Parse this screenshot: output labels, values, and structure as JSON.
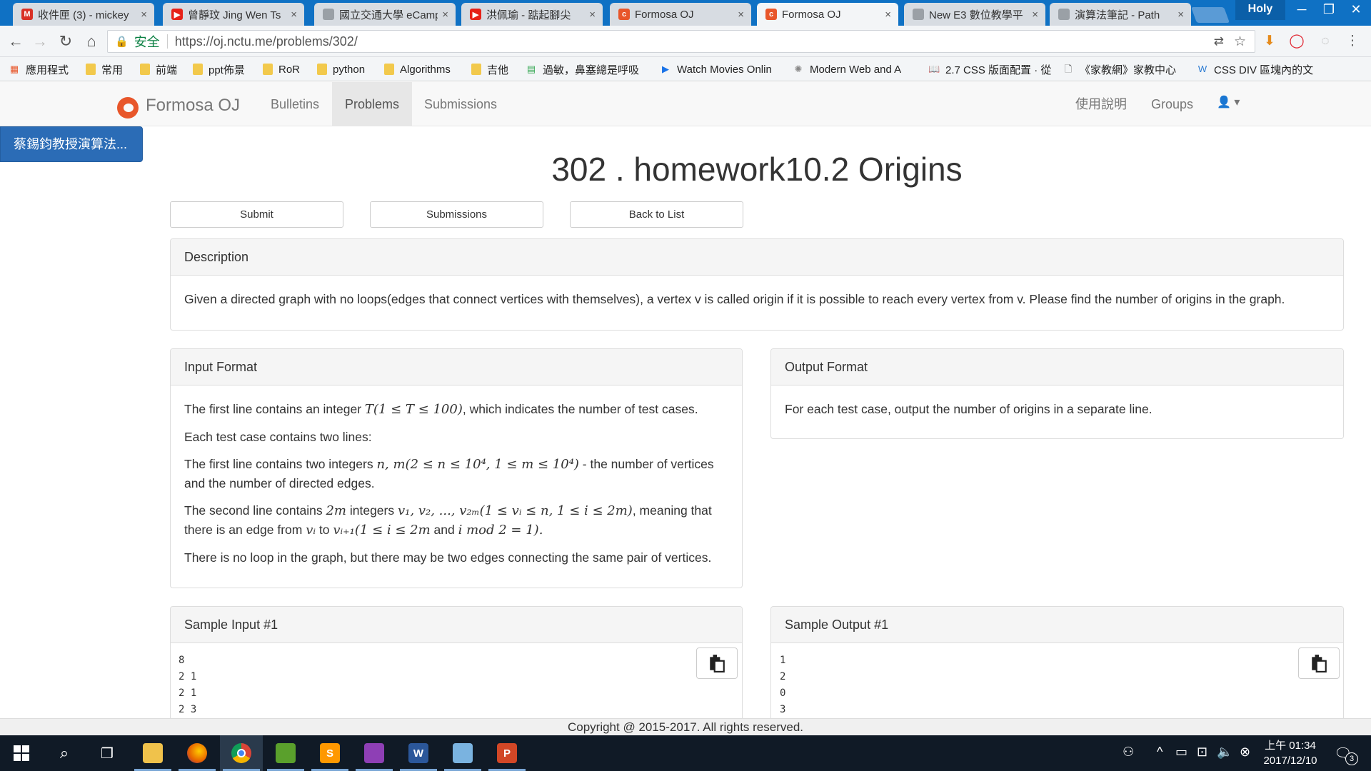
{
  "browser": {
    "tabs": [
      {
        "title": "收件匣 (3) - mickey",
        "icon": "gmail-icon",
        "color": "#d93025",
        "glyph": "M"
      },
      {
        "title": "曾靜玟 Jing Wen Ts",
        "icon": "youtube-icon",
        "color": "#e62117",
        "glyph": "▶"
      },
      {
        "title": "國立交通大學 eCamp",
        "icon": "document-icon",
        "color": "#9aa0a6",
        "glyph": ""
      },
      {
        "title": "洪佩瑜 - 踮起腳尖",
        "icon": "youtube-icon",
        "color": "#e62117",
        "glyph": "▶"
      },
      {
        "title": "Formosa OJ",
        "icon": "formosa-oj-icon",
        "color": "#e8562a",
        "glyph": "c"
      },
      {
        "title": "Formosa OJ",
        "icon": "formosa-oj-icon",
        "color": "#e8562a",
        "glyph": "c"
      },
      {
        "title": "New E3 數位教學平",
        "icon": "document-icon",
        "color": "#9aa0a6",
        "glyph": ""
      },
      {
        "title": "演算法筆記 - Path",
        "icon": "document-icon",
        "color": "#9aa0a6",
        "glyph": ""
      }
    ],
    "profile_name": "Holy",
    "secure_label": "安全",
    "url": "https://oj.nctu.me/problems/302/",
    "bookmarks": [
      {
        "label": "應用程式",
        "icon": "apps-grid-icon",
        "kind": "icon",
        "glyph": "▦",
        "color": "#e8562a"
      },
      {
        "label": "常用",
        "kind": "folder"
      },
      {
        "label": "前端",
        "kind": "folder"
      },
      {
        "label": "ppt佈景",
        "kind": "folder"
      },
      {
        "label": "RoR",
        "kind": "folder"
      },
      {
        "label": "python",
        "kind": "folder"
      },
      {
        "label": "Algorithms",
        "kind": "folder"
      },
      {
        "label": "吉他",
        "kind": "folder"
      },
      {
        "label": "過敏，鼻塞總是呼吸",
        "icon": "sheet-icon",
        "kind": "icon",
        "glyph": "▤",
        "color": "#34a853"
      },
      {
        "label": "Watch Movies Onlin",
        "icon": "play-circle-icon",
        "kind": "icon",
        "glyph": "▶",
        "color": "#1a73e8"
      },
      {
        "label": "Modern Web and A",
        "icon": "globe-icon",
        "kind": "icon",
        "glyph": "✺",
        "color": "#888"
      },
      {
        "label": "2.7 CSS 版面配置 · 從",
        "icon": "book-icon",
        "kind": "icon",
        "glyph": "📖",
        "color": "#333"
      },
      {
        "label": "《家教網》家教中心",
        "icon": "document-icon",
        "kind": "icon",
        "glyph": "🗋",
        "color": "#555"
      },
      {
        "label": "CSS DIV 區塊內的文",
        "icon": "w-icon",
        "kind": "icon",
        "glyph": "W",
        "color": "#2b7bd3"
      }
    ]
  },
  "site": {
    "brand": "Formosa OJ",
    "nav": {
      "bulletins": "Bulletins",
      "problems": "Problems",
      "submissions": "Submissions",
      "help": "使用說明",
      "groups": "Groups"
    },
    "course_chip": "蔡錫鈞教授演算法..."
  },
  "problem": {
    "title": "302 . homework10.2 Origins",
    "buttons": {
      "submit": "Submit",
      "submissions": "Submissions",
      "back": "Back to List"
    },
    "description": {
      "heading": "Description",
      "text": "Given a directed graph with no loops(edges that connect vertices with themselves), a vertex v is called origin if it is possible to reach every vertex from v. Please find the number of origins in the graph."
    },
    "input_format": {
      "heading": "Input Format",
      "p1_pre": "The first line contains an integer ",
      "p1_math": "T(1 ≤ T ≤ 100)",
      "p1_post": ", which indicates the number of test cases.",
      "p2": "Each test case contains two lines:",
      "p3_pre": "The first line contains two integers ",
      "p3_math": "n, m(2 ≤ n ≤ 10⁴, 1 ≤ m ≤ 10⁴)",
      "p3_post": " - the number of vertices and the number of directed edges.",
      "p4_a": "The second line contains ",
      "p4_m1": "2m",
      "p4_b": " integers ",
      "p4_m2": "v₁, v₂, ..., v₂ₘ(1 ≤ vᵢ ≤ n, 1 ≤ i ≤ 2m)",
      "p4_c": ", meaning that there is an edge from ",
      "p4_m3": "vᵢ",
      "p4_d": " to ",
      "p4_m4": "vᵢ₊₁(1 ≤ i ≤ 2m",
      "p4_e": " and ",
      "p4_m5": "i  mod 2 = 1).",
      "p5": "There is no loop in the graph, but there may be two edges connecting the same pair of vertices."
    },
    "output_format": {
      "heading": "Output Format",
      "text": "For each test case, output the number of origins in a separate line."
    },
    "sample_input": {
      "heading": "Sample Input #1",
      "lines": "8\n2 1\n2 1\n2 3"
    },
    "sample_output": {
      "heading": "Sample Output #1",
      "lines": "1\n2\n0\n3"
    }
  },
  "footer": {
    "copyright": "Copyright @ 2015-2017. All rights reserved."
  },
  "taskbar": {
    "apps": [
      {
        "name": "file-explorer-icon",
        "glyph": "",
        "color": "#f0c24b"
      },
      {
        "name": "firefox-icon",
        "glyph": "",
        "color": "#e66000"
      },
      {
        "name": "chrome-icon",
        "glyph": "",
        "color": "#4285f4"
      },
      {
        "name": "image-editor-icon",
        "glyph": "",
        "color": "#5aa02c"
      },
      {
        "name": "sublime-text-icon",
        "glyph": "S",
        "color": "#ff9800"
      },
      {
        "name": "winrar-icon",
        "glyph": "",
        "color": "#8e3fb5"
      },
      {
        "name": "word-icon",
        "glyph": "W",
        "color": "#2b579a"
      },
      {
        "name": "paint-icon",
        "glyph": "",
        "color": "#7ab3e0"
      },
      {
        "name": "powerpoint-icon",
        "glyph": "P",
        "color": "#d24726"
      }
    ],
    "clock_period": "上午 01:34",
    "clock_date": "2017/12/10",
    "notification_count": "3"
  }
}
